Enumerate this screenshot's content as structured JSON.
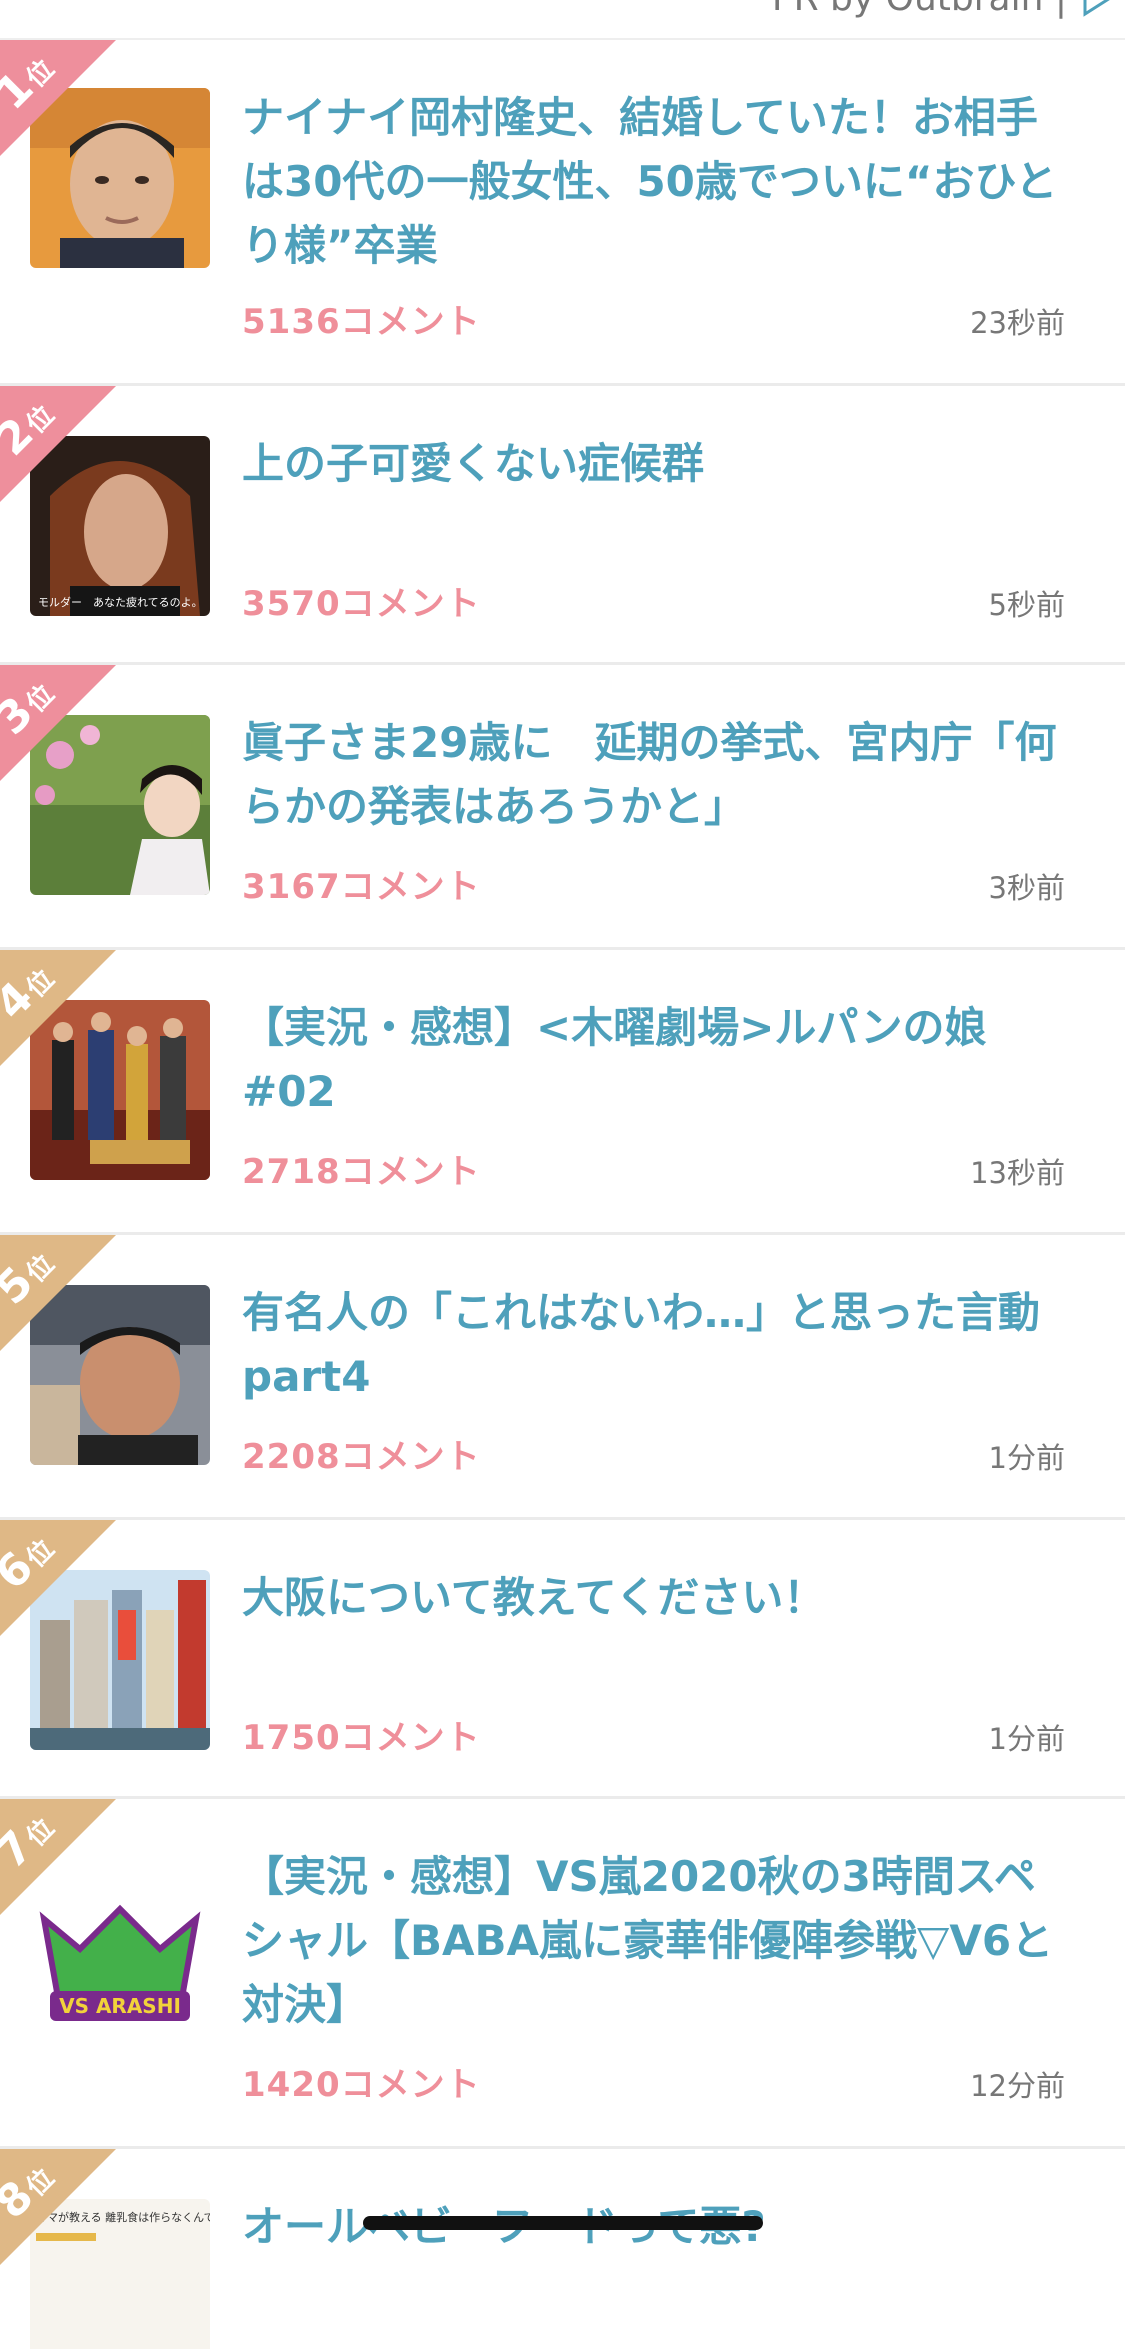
{
  "header": {
    "credit": "PR by Outbrain |"
  },
  "rank_suffix": "位",
  "items": [
    {
      "rank": "1",
      "title": "ナイナイ岡村隆史、結婚していた！お相手は30代の一般女性、50歳でついに“おひとり様”卒業",
      "comments": "5136コメント",
      "time": "23秒前"
    },
    {
      "rank": "2",
      "title": "上の子可愛くない症候群",
      "comments": "3570コメント",
      "time": "5秒前",
      "thumb_caption": "モルダー　あなた疲れてるのよ。"
    },
    {
      "rank": "3",
      "title": "眞子さま29歳に　延期の挙式、宮内庁「何らかの発表はあろうかと」",
      "comments": "3167コメント",
      "time": "3秒前"
    },
    {
      "rank": "4",
      "title": "【実況・感想】<木曜劇場>ルパンの娘 #02",
      "comments": "2718コメント",
      "time": "13秒前"
    },
    {
      "rank": "5",
      "title": "有名人の「これはないわ…」と思った言動part4",
      "comments": "2208コメント",
      "time": "1分前"
    },
    {
      "rank": "6",
      "title": "大阪について教えてください！",
      "comments": "1750コメント",
      "time": "1分前"
    },
    {
      "rank": "7",
      "title": "【実況・感想】VS嵐2020秋の3時間スペシャル【BABA嵐に豪華俳優陣参戦▽V6と対決】",
      "comments": "1420コメント",
      "time": "12分前",
      "thumb_caption": "VS ARASHI"
    },
    {
      "rank": "8",
      "title": "オールベビーフードって悪?",
      "comments": "",
      "time": "",
      "thumb_caption": "ママが教える 離乳食は作らなくんです。"
    }
  ],
  "colors": {
    "title": "#4ea0bb",
    "comments": "#ef8f9a",
    "rank_pink": "#ee8f9c",
    "rank_gold": "#dfb886"
  }
}
